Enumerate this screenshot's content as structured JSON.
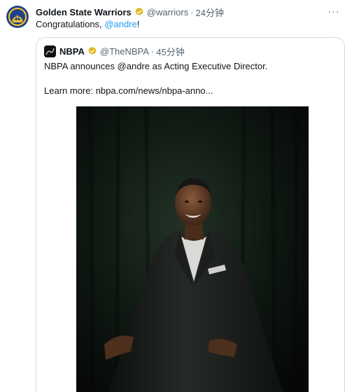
{
  "tweet": {
    "author_name": "Golden State Warriors",
    "handle": "@warriors",
    "separator": "·",
    "time": "24分钟",
    "more": "···",
    "text_prefix": "Congratulations, ",
    "mention": "@andre",
    "text_suffix": "!"
  },
  "quote": {
    "author_name": "NBPA",
    "handle": "@TheNBPA",
    "separator": "·",
    "time": "45分钟",
    "text": "NBPA announces @andre as Acting Executive Director.",
    "link_prefix": "Learn more: ",
    "link_url": "nbpa.com/news/nbpa-anno..."
  },
  "colors": {
    "accent": "#1d9bf0",
    "verified_gold": "#e2b719",
    "warriors_blue": "#1d428a",
    "warriors_gold": "#ffc72c",
    "secondary_text": "#536471",
    "border": "#cfd9de"
  },
  "icons": {
    "main_avatar": "warriors-logo",
    "verified": "gold-verified-badge",
    "quote_avatar": "nbpa-logo",
    "more": "ellipsis-icon"
  }
}
